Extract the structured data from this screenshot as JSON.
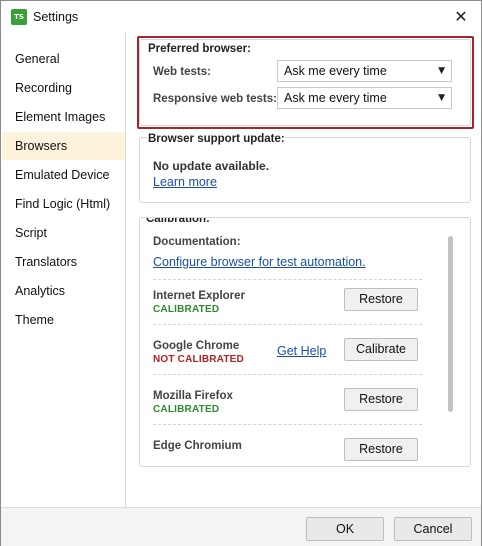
{
  "window": {
    "title": "Settings",
    "app_badge": "TS"
  },
  "sidebar": {
    "items": [
      {
        "label": "General",
        "active": false
      },
      {
        "label": "Recording",
        "active": false
      },
      {
        "label": "Element Images",
        "active": false
      },
      {
        "label": "Browsers",
        "active": true
      },
      {
        "label": "Emulated Device",
        "active": false
      },
      {
        "label": "Find Logic (Html)",
        "active": false
      },
      {
        "label": "Script",
        "active": false
      },
      {
        "label": "Translators",
        "active": false
      },
      {
        "label": "Analytics",
        "active": false
      },
      {
        "label": "Theme",
        "active": false
      }
    ]
  },
  "preferred_browser": {
    "title": "Preferred browser:",
    "web_tests_label": "Web tests:",
    "web_tests_value": "Ask me every time",
    "responsive_label": "Responsive web tests:",
    "responsive_value": "Ask me every time"
  },
  "support_update": {
    "title": "Browser support update:",
    "status": "No update available.",
    "learn_more": "Learn more"
  },
  "calibration": {
    "title": "Calibration:",
    "doc_label": "Documentation:",
    "doc_link": "Configure browser for test automation.",
    "browsers": [
      {
        "name": "Internet Explorer",
        "status": "CALIBRATED",
        "button": "Restore"
      },
      {
        "name": "Google Chrome",
        "status": "NOT CALIBRATED",
        "help": "Get Help",
        "button": "Calibrate"
      },
      {
        "name": "Mozilla Firefox",
        "status": "CALIBRATED",
        "button": "Restore"
      },
      {
        "name": "Edge Chromium",
        "status": "",
        "button": "Restore"
      }
    ]
  },
  "footer": {
    "ok": "OK",
    "cancel": "Cancel"
  },
  "colors": {
    "highlight": "#a3262e",
    "calibrated": "#2f8a2f",
    "not_calibrated": "#b02323",
    "link": "#1a4fa8",
    "active_sidebar": "#fdf3dc"
  }
}
